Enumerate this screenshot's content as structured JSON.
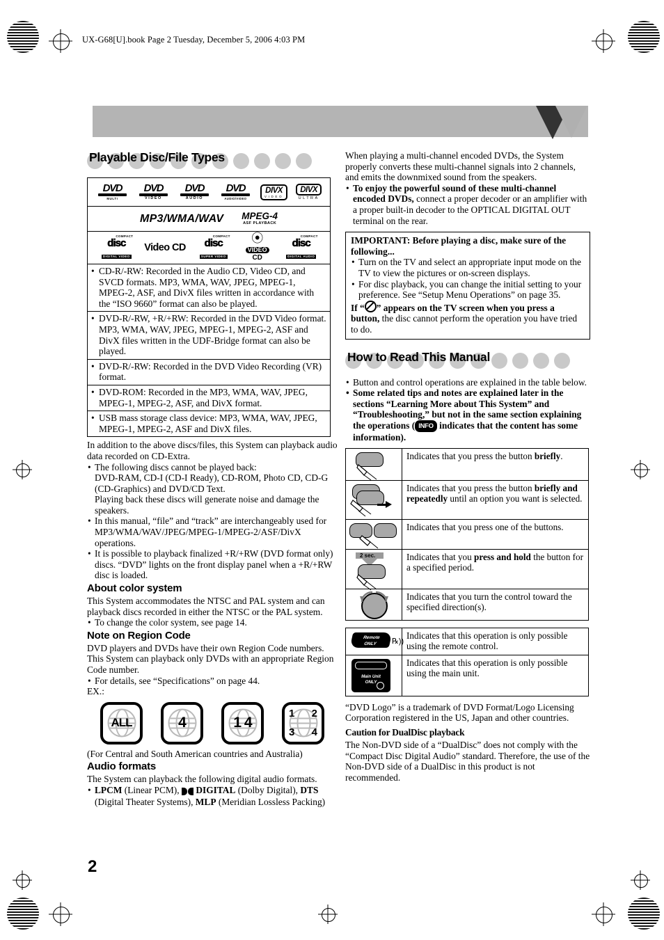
{
  "file_header": "UX-G68[U].book  Page 2  Tuesday, December 5, 2006  4:03 PM",
  "page_number": "2",
  "left_column": {
    "section_title": "Playable Disc/File Types",
    "logo_rows": [
      {
        "logos": [
          {
            "name": "dvd-multi-logo",
            "top": "DVD",
            "sub": ""
          },
          {
            "name": "dvd-video-logo",
            "top": "DVD",
            "sub": "VIDEO"
          },
          {
            "name": "dvd-audio-logo",
            "top": "DVD",
            "sub": "AUDIO"
          },
          {
            "name": "dvd-audio-video-logo",
            "top": "DVD",
            "sub": "AUDIO/VIDEO"
          },
          {
            "name": "divx-video-logo",
            "top": "DIVX",
            "sub": "VIDEO"
          },
          {
            "name": "divx-ultra-logo",
            "top": "DIVX",
            "sub": "ULTRA"
          }
        ]
      },
      {
        "mp3_text": "MP3/WMA/WAV",
        "mpeg4_title": "MPEG-4",
        "mpeg4_sub": "ASF PLAYBACK"
      },
      {
        "logos": [
          {
            "name": "cd-digital-video-logo",
            "cap": "COMPACT",
            "disc": "disc",
            "foot": "DIGITAL VIDEO"
          },
          {
            "name": "video-cd-logo",
            "text": "Video CD"
          },
          {
            "name": "cd-super-video-logo",
            "cap": "COMPACT",
            "disc": "disc",
            "foot": "SUPER VIDEO"
          },
          {
            "name": "video-cd-swirl-logo",
            "text_top": "VIDEO",
            "text_bottom": "CD"
          },
          {
            "name": "cd-digital-audio-logo",
            "cap": "COMPACT",
            "disc": "disc",
            "foot": "DIGITAL AUDIO"
          }
        ]
      }
    ],
    "disc_types": [
      "CD-R/-RW: Recorded in the Audio CD, Video CD, and SVCD formats. MP3, WMA, WAV, JPEG, MPEG-1, MPEG-2, ASF, and DivX files written in accordance with the “ISO 9660” format can also be played.",
      "DVD-R/-RW, +R/+RW: Recorded in the DVD Video format. MP3, WMA, WAV, JPEG, MPEG-1, MPEG-2, ASF and DivX files written in the UDF-Bridge format can also be played.",
      "DVD-R/-RW: Recorded in the DVD Video Recording (VR) format.",
      "DVD-ROM: Recorded in the MP3, WMA, WAV, JPEG, MPEG-1, MPEG-2, ASF, and DivX format.",
      "USB mass storage class device: MP3, WMA, WAV, JPEG, MPEG-1, MPEG-2, ASF and DivX files."
    ],
    "intro_paragraph": "In addition to the above discs/files, this System can playback audio data recorded on CD-Extra.",
    "bullet_cannot_play_head": "The following discs cannot be played back:",
    "bullet_cannot_play_list": "DVD-RAM, CD-I (CD-I Ready), CD-ROM, Photo CD, CD-G (CD-Graphics) and DVD/CD Text.",
    "bullet_cannot_play_tail": "Playing back these discs will generate noise and damage the speakers.",
    "bullet_file_track": "In this manual, “file” and “track” are interchangeably used for MP3/WMA/WAV/JPEG/MPEG-1/MPEG-2/ASF/DivX operations.",
    "bullet_finalized": "It is possible to playback finalized +R/+RW (DVD format only) discs. “DVD” lights on the front display panel when a +R/+RW disc is loaded.",
    "color_system_head": "About color system",
    "color_system_body": "This System accommodates the NTSC and PAL system and can playback discs recorded in either the NTSC or the PAL system.",
    "color_system_bullet": "To change the color system, see page 14.",
    "region_code_head": "Note on Region Code",
    "region_code_body": "DVD players and DVDs have their own Region Code numbers. This System can playback only DVDs with an appropriate Region Code number.",
    "region_code_bullet": "For details, see “Specifications” on page 44.",
    "ex_label": "EX.:",
    "region_icons": [
      {
        "name": "region-code-all",
        "label": "ALL"
      },
      {
        "name": "region-code-4",
        "label": "4"
      },
      {
        "name": "region-code-1-4",
        "label": "1 4"
      },
      {
        "name": "region-code-1234",
        "labels": [
          "1",
          "2",
          "3",
          "4"
        ]
      }
    ],
    "region_note": "(For Central and South American countries and Australia)",
    "audio_formats_head": "Audio formats",
    "audio_formats_body": "The System can playback the following digital audio formats.",
    "audio_formats_bullet_1": "LPCM",
    "audio_formats_bullet_1b": " (Linear PCM), ",
    "audio_formats_bullet_2": "DIGITAL",
    "audio_formats_bullet_2b": " (Dolby Digital), ",
    "audio_formats_bullet_3": "DTS",
    "audio_formats_bullet_3b": " (Digital Theater Systems), ",
    "audio_formats_bullet_4": "MLP",
    "audio_formats_bullet_4b": " (Meridian Lossless Packing)"
  },
  "right_column": {
    "multichannel_paragraph": "When playing a multi-channel encoded DVDs, the System properly converts these multi-channel signals into 2 channels, and emits the downmixed sound from the speakers.",
    "multichannel_bullet_bold": "To enjoy the powerful sound of these multi-channel encoded DVDs,",
    "multichannel_bullet_rest": " connect a proper decoder or an amplifier with a proper built-in decoder to the OPTICAL DIGITAL OUT terminal on the rear.",
    "important_box": {
      "heading": "IMPORTANT: Before playing a disc, make sure of the following...",
      "bullets": [
        "Turn on the TV and select an appropriate input mode on the TV to view the pictures or on-screen displays.",
        "For disc playback, you can change the initial setting to your preference. See “Setup Menu Operations” on page 35."
      ],
      "footer_bold_1": "If “",
      "footer_bold_2": "” appears on the TV screen when you press a button,",
      "footer_rest": " the disc cannot perform the operation you have tried to do."
    },
    "section_title": "How to Read This Manual",
    "bullet_table": "Button and control operations are explained in the table below.",
    "bullet_tips_a": "Some related tips and notes are explained later in the sections “Learning More about This System” and “Troubleshooting,” but not in the same section explaining the operations (",
    "info_badge": "INFO",
    "bullet_tips_b": " indicates that the content has some information).",
    "icon_table": [
      {
        "icon": "press-briefly-icon",
        "text_pre": "Indicates that you press the button ",
        "text_bold": "briefly",
        "text_post": "."
      },
      {
        "icon": "press-repeatedly-icon",
        "text_pre": "Indicates that you press the button ",
        "text_bold": "briefly and repeatedly",
        "text_post": " until an option you want is selected."
      },
      {
        "icon": "press-one-of-buttons-icon",
        "text_pre": "Indicates that you press one of the buttons.",
        "text_bold": "",
        "text_post": ""
      },
      {
        "icon": "press-and-hold-icon",
        "icon_label": "2 sec.",
        "text_pre": "Indicates that you ",
        "text_bold": "press and hold",
        "text_post": " the button for a specified period."
      },
      {
        "icon": "turn-control-icon",
        "text_pre": "Indicates that you turn the control toward the specified direction(s).",
        "text_bold": "",
        "text_post": ""
      }
    ],
    "device_table": [
      {
        "icon": "remote-only-badge",
        "badge_line1": "Remote",
        "badge_line2": "ONLY",
        "text": "Indicates that this operation is only possible using the remote control."
      },
      {
        "icon": "main-unit-only-badge",
        "badge_line1": "Main Unit",
        "badge_line2": "ONLY",
        "text": "Indicates that this operation is only possible using the main unit."
      }
    ],
    "trademark_paragraph": "“DVD Logo” is a trademark of DVD Format/Logo Licensing Corporation registered in the US, Japan and other countries.",
    "dualdisc_head": "Caution for DualDisc playback",
    "dualdisc_body": "The Non-DVD side of a “DualDisc” does not comply with the “Compact Disc Digital Audio” standard. Therefore, the use of the Non-DVD side of a DualDisc in this product is not recommended."
  }
}
